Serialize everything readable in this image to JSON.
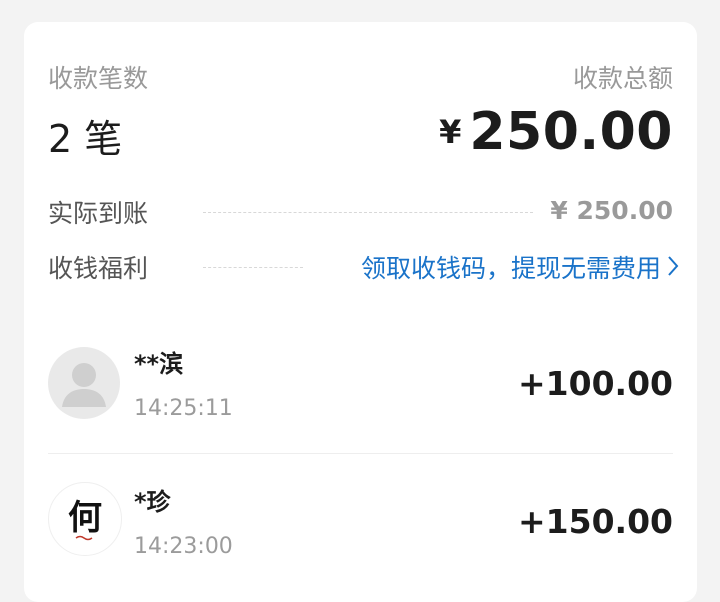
{
  "summary": {
    "count_label": "收款笔数",
    "count_value": "2 笔",
    "total_label": "收款总额",
    "currency_symbol": "¥",
    "total_amount": "250.00"
  },
  "details": {
    "actual_label": "实际到账",
    "actual_value": "¥ 250.00",
    "benefit_label": "收钱福利",
    "benefit_link": "领取收钱码，提现无需费用",
    "benefit_icon": "chevron-right-icon"
  },
  "transactions": [
    {
      "name": "**滨",
      "time": "14:25:11",
      "amount": "+100.00",
      "avatar": "default-person-icon"
    },
    {
      "name": "*珍",
      "time": "14:23:00",
      "amount": "+150.00",
      "avatar": "calligraphy-avatar",
      "avatar_char": "何"
    }
  ],
  "colors": {
    "background": "#f3f3f3",
    "card": "#ffffff",
    "link": "#1a73c9",
    "muted": "#999999",
    "text": "#1c1c1c"
  }
}
